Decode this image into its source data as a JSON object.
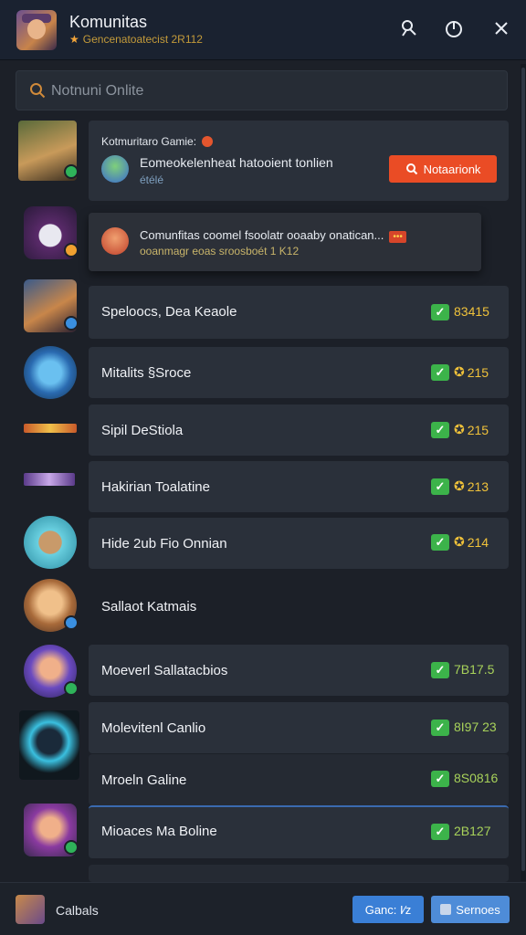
{
  "header": {
    "title": "Komunitas",
    "subtitle": "Gencenatoatecist 2R112",
    "icons": [
      "search-person-icon",
      "power-icon",
      "close-icon"
    ]
  },
  "search": {
    "placeholder": "Notnuni Onlite"
  },
  "notifications": [
    {
      "title": "Kotmuritaro Gamie:",
      "text": "Eomeokelenheat hatooient tonlien",
      "sub": "étélé",
      "button": "Notaarionk"
    },
    {
      "text": "Comunfitas coomel fsoolatr ooaaby onatican...",
      "tag": "•••",
      "sub": "ooanmagr eoas sroosboét 1 K12"
    }
  ],
  "rows": [
    {
      "name": "Speloocs, Dea Keaole",
      "score": "83415"
    },
    {
      "name": "Mitalits §Sroce",
      "score": "215"
    },
    {
      "name": "Sipil DeStiola",
      "score": "215"
    },
    {
      "name": "Hakirian Toalatine",
      "score": "213"
    },
    {
      "name": "Hide 2ub Fio Onnian",
      "score": "214"
    },
    {
      "name": "Sallaot Katmais",
      "score": ""
    },
    {
      "name": "Moeverl Sallatacbios",
      "score": "7B17.5"
    },
    {
      "name": "Molevitenl Canlio",
      "score": "8I97 23"
    },
    {
      "name": "Mroeln Galine",
      "score": "8S0816"
    },
    {
      "name": "Mioaces Ma Boline",
      "score": "2B127"
    }
  ],
  "footer": {
    "label": "Calbals",
    "button_primary": "Ganc: I⁄z",
    "button_secondary": "Sernoes"
  },
  "colors": {
    "accent_orange": "#ea4c25",
    "check_green": "#3cb34a",
    "score_gold": "#f0c23a",
    "footer_blue": "#3a7fd6"
  }
}
